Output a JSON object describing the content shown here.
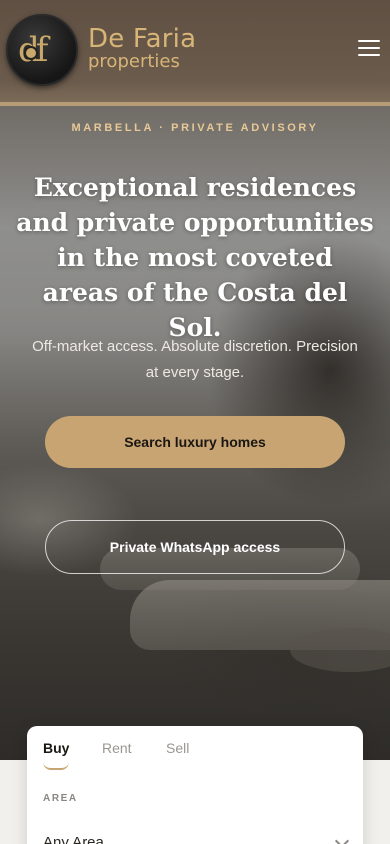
{
  "header": {
    "logo_monogram": "df",
    "brand_name": "De Faria",
    "brand_sub": "properties",
    "menu_icon": "hamburger-icon"
  },
  "hero": {
    "eyebrow": "MARBELLA · PRIVATE ADVISORY",
    "headline": "Exceptional residences and private opportunities in the most coveted areas of the Costa del Sol.",
    "subtext": "Off-market access. Absolute discretion. Precision at every stage.",
    "primary_cta": "Search luxury homes",
    "secondary_cta": "Private WhatsApp access"
  },
  "search": {
    "tabs": [
      {
        "label": "Buy"
      },
      {
        "label": "Rent"
      },
      {
        "label": "Sell"
      }
    ],
    "area_label": "AREA",
    "area_value": "Any Area"
  },
  "colors": {
    "accent": "#c8a473",
    "brand_gold": "#d8b577",
    "header_bg": "#6b5b4c"
  }
}
